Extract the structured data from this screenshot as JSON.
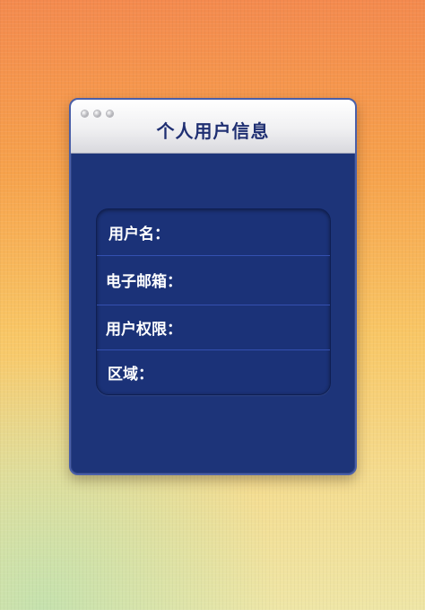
{
  "window": {
    "title": "个人用户信息"
  },
  "profile": {
    "fields": [
      {
        "label": "用户名：",
        "value": ""
      },
      {
        "label": "电子邮箱：",
        "value": ""
      },
      {
        "label": "用户权限：",
        "value": ""
      },
      {
        "label": "区域：",
        "value": ""
      }
    ]
  },
  "colors": {
    "panel": "#1d3479",
    "title_text": "#1f2f72",
    "background_top": "#f48a4e",
    "background_bottom": "#efe6a6"
  }
}
